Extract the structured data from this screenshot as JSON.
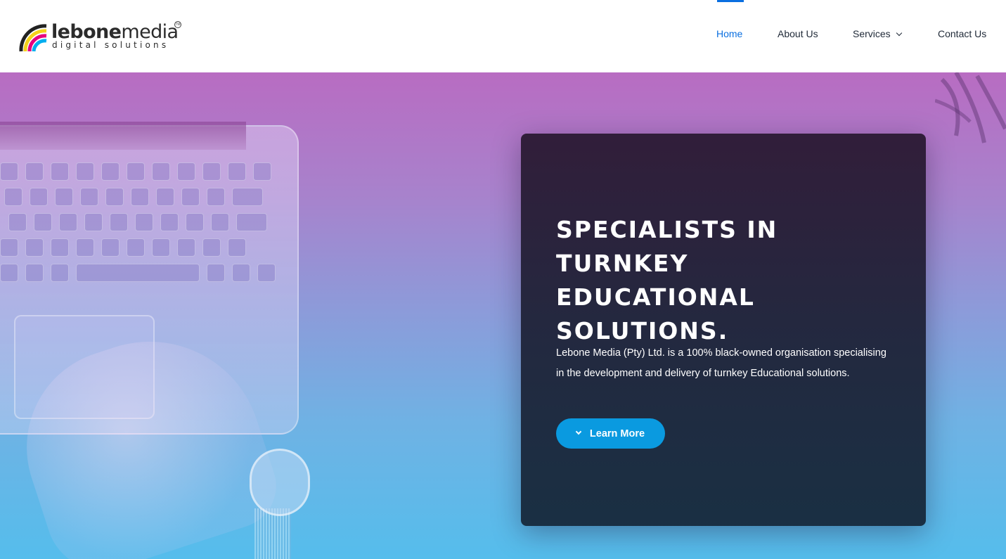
{
  "logo": {
    "word_bold": "lebone",
    "word_light": "media",
    "tagline": "digital solutions",
    "trademark": "TM",
    "arc_colors": [
      "#f4d11b",
      "#e6007e",
      "#00aeef",
      "#222222"
    ]
  },
  "nav": {
    "items": [
      {
        "label": "Home",
        "active": true
      },
      {
        "label": "About Us",
        "active": false
      },
      {
        "label": "Services",
        "active": false,
        "has_dropdown": true
      },
      {
        "label": "Contact Us",
        "active": false
      }
    ]
  },
  "hero": {
    "title": "SPECIALISTS IN TURNKEY EDUCATIONAL SOLUTIONS.",
    "description": "Lebone Media (Pty) Ltd. is a 100% black-owned organisation specialising in the development and delivery of turnkey Educational solutions.",
    "cta_label": "Learn More",
    "cta_icon": "chevron-down-icon"
  },
  "colors": {
    "accent": "#0a6fe0",
    "button": "#0a9ae0",
    "card_bg": "#1f2a3f",
    "gradient_top": "#b86cc2",
    "gradient_bottom": "#55bdec"
  }
}
